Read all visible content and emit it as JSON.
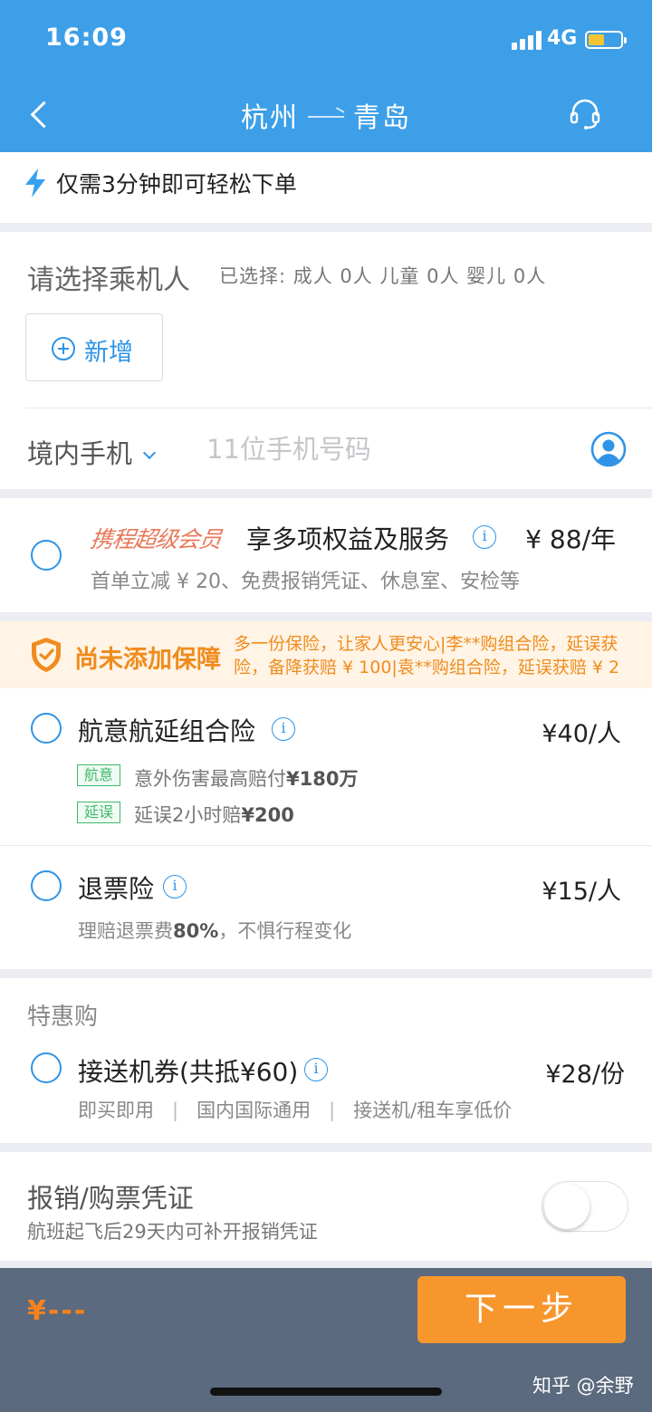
{
  "status_bar": {
    "time": "16:09",
    "network": "4G"
  },
  "header": {
    "from": "杭州",
    "to": "青岛"
  },
  "notice": {
    "text": "仅需3分钟即可轻松下单"
  },
  "passengers": {
    "title": "请选择乘机人",
    "selected_summary": "已选择: 成人 0人  儿童 0人  婴儿 0人",
    "add_label": "新增",
    "phone_type": "境内手机",
    "phone_placeholder": "11位手机号码",
    "phone_value": ""
  },
  "membership": {
    "logo_text": "携程超级会员",
    "title": "享多项权益及服务",
    "price": "¥ 88/年",
    "desc": "首单立减 ¥ 20、免费报销凭证、休息室、安检等"
  },
  "insurance_warning": {
    "title": "尚未添加保障",
    "line1": "多一份保险，让家人更安心|李**购组合险，延误获",
    "line2": "险，备降获赔 ¥ 100|袁**购组合险，延误获赔 ¥ 2"
  },
  "insurance": {
    "combo": {
      "name": "航意航延组合险",
      "price": "¥40/人",
      "tag1": "航意",
      "detail1_prefix": "意外伤害最高赔付",
      "detail1_value": "¥180万",
      "tag2": "延误",
      "detail2_prefix": "延误2小时赔",
      "detail2_value": "¥200"
    },
    "refund": {
      "name": "退票险",
      "price": "¥15/人",
      "desc_prefix": "理赔退票费",
      "desc_value": "80%",
      "desc_suffix": "，不惧行程变化"
    }
  },
  "deals": {
    "title": "特惠购",
    "item_name": "接送机券(共抵¥60)",
    "item_price": "¥28/份",
    "feature1": "即买即用",
    "feature2": "国内国际通用",
    "feature3": "接送机/租车享低价"
  },
  "invoice": {
    "title": "报销/购票凭证",
    "desc": "航班起飞后29天内可补开报销凭证",
    "enabled": false
  },
  "footer": {
    "total": "¥---",
    "next_label": "下一步",
    "watermark": "知乎 @余野"
  },
  "colors": {
    "header_blue": "#3d9fe8",
    "accent_blue": "#2f94e6",
    "warning_orange": "#f08c1d",
    "button_orange": "#f7962d",
    "tag_green": "#3fb86b",
    "footer_slate": "#5b6a7e"
  },
  "icons": [
    "back-arrow-icon",
    "headset-icon",
    "lightning-icon",
    "plus-circle-icon",
    "chevron-down-icon",
    "contact-icon",
    "info-icon",
    "shield-icon"
  ]
}
